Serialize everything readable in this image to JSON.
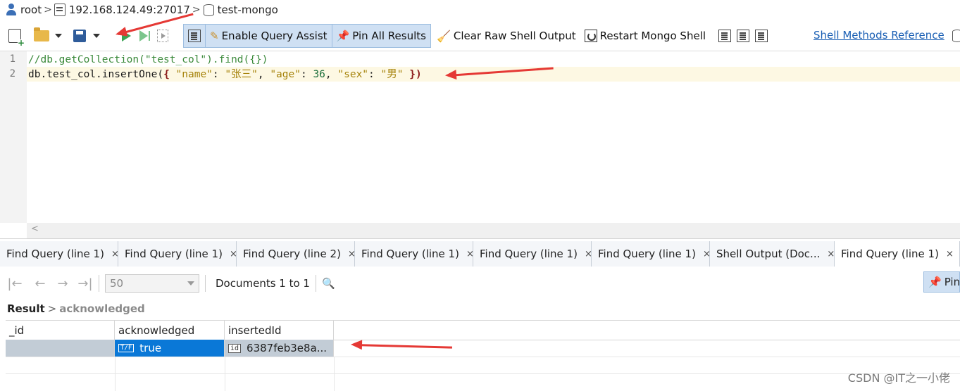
{
  "breadcrumb": {
    "user": "root",
    "server": "192.168.124.49:27017",
    "database": "test-mongo"
  },
  "toolbar": {
    "enable_query_assist": "Enable Query Assist",
    "pin_all_results": "Pin All Results",
    "clear_raw_shell_output": "Clear Raw Shell Output",
    "restart_mongo_shell": "Restart Mongo Shell",
    "shell_methods_reference": "Shell Methods Reference"
  },
  "editor": {
    "lines": [
      {
        "num": "1",
        "text": "//db.getCollection(\"test_col\").find({})"
      },
      {
        "num": "2",
        "prefix": "db.test_col.insertOne(",
        "brace_open": "{",
        "k1": "\"name\"",
        "c1": ": ",
        "v1": "\"张三\"",
        "s1": ", ",
        "k2": "\"age\"",
        "c2": ": ",
        "v2": "36",
        "s2": ", ",
        "k3": "\"sex\"",
        "c3": ": ",
        "v3": "\"男\"",
        "sp": " ",
        "brace_close": "}",
        "suffix": ")"
      }
    ],
    "scroll_glyph": "<"
  },
  "tabs": [
    {
      "label": "Find Query (line 1)",
      "close": "×"
    },
    {
      "label": "Find Query (line 1)",
      "close": "×"
    },
    {
      "label": "Find Query (line 2)",
      "close": "×"
    },
    {
      "label": "Find Query (line 1)",
      "close": "×"
    },
    {
      "label": "Find Query (line 1)",
      "close": "×"
    },
    {
      "label": "Find Query (line 1)",
      "close": "×"
    },
    {
      "label": "Shell Output (Doc...",
      "close": "×"
    },
    {
      "label": "Find Query (line 1)",
      "close": "×"
    }
  ],
  "results_toolbar": {
    "page_size": "50",
    "documents_label": "Documents 1 to 1",
    "pin_label": "Pin"
  },
  "result_breadcrumb": {
    "root": "Result",
    "child": "acknowledged"
  },
  "grid": {
    "columns": [
      "_id",
      "acknowledged",
      "insertedId"
    ],
    "rows": [
      {
        "id": "",
        "acknowledged_badge": "T/F",
        "acknowledged": "true",
        "insertedId_badge": "id",
        "insertedId": "6387feb3e8a..."
      }
    ]
  },
  "watermark": "CSDN @IT之一小佬",
  "colors": {
    "accent_link": "#1a5fb4",
    "selected_cell": "#0a78d7",
    "active_button": "#cfe0f3",
    "arrow": "#e53935"
  }
}
